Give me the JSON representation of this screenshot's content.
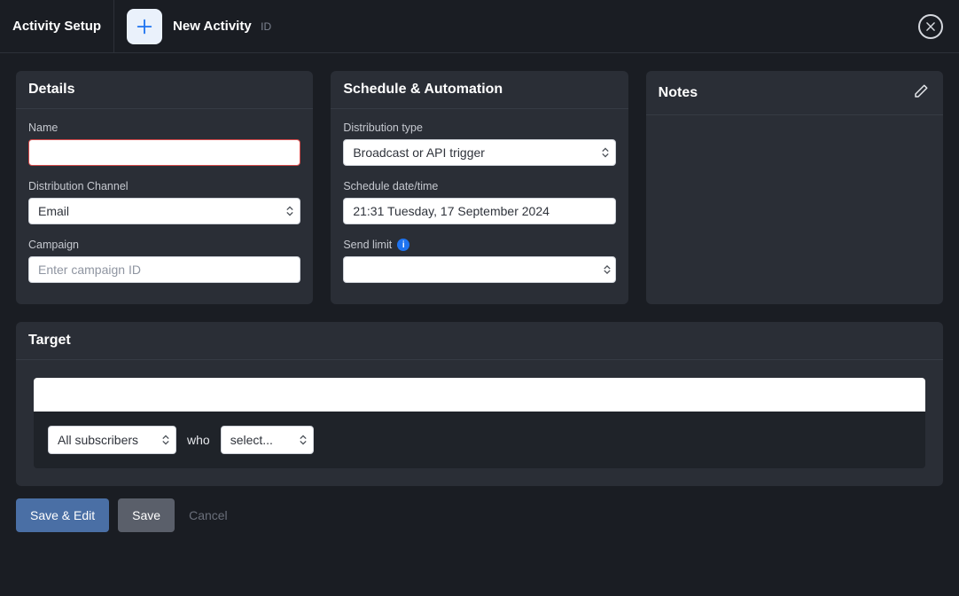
{
  "header": {
    "title": "Activity Setup",
    "activity_name": "New Activity",
    "id_label": "ID"
  },
  "details": {
    "title": "Details",
    "name_label": "Name",
    "name_value": "",
    "channel_label": "Distribution Channel",
    "channel_value": "Email",
    "campaign_label": "Campaign",
    "campaign_placeholder": "Enter campaign ID",
    "campaign_value": ""
  },
  "schedule": {
    "title": "Schedule & Automation",
    "dist_type_label": "Distribution type",
    "dist_type_value": "Broadcast or API trigger",
    "schedule_label": "Schedule date/time",
    "schedule_value": "21:31 Tuesday, 17 September 2024",
    "send_limit_label": "Send limit",
    "send_limit_value": ""
  },
  "notes": {
    "title": "Notes"
  },
  "target": {
    "title": "Target",
    "audience_value": "All subscribers",
    "who_text": "who",
    "filter_value": "select..."
  },
  "footer": {
    "save_edit": "Save & Edit",
    "save": "Save",
    "cancel": "Cancel"
  }
}
